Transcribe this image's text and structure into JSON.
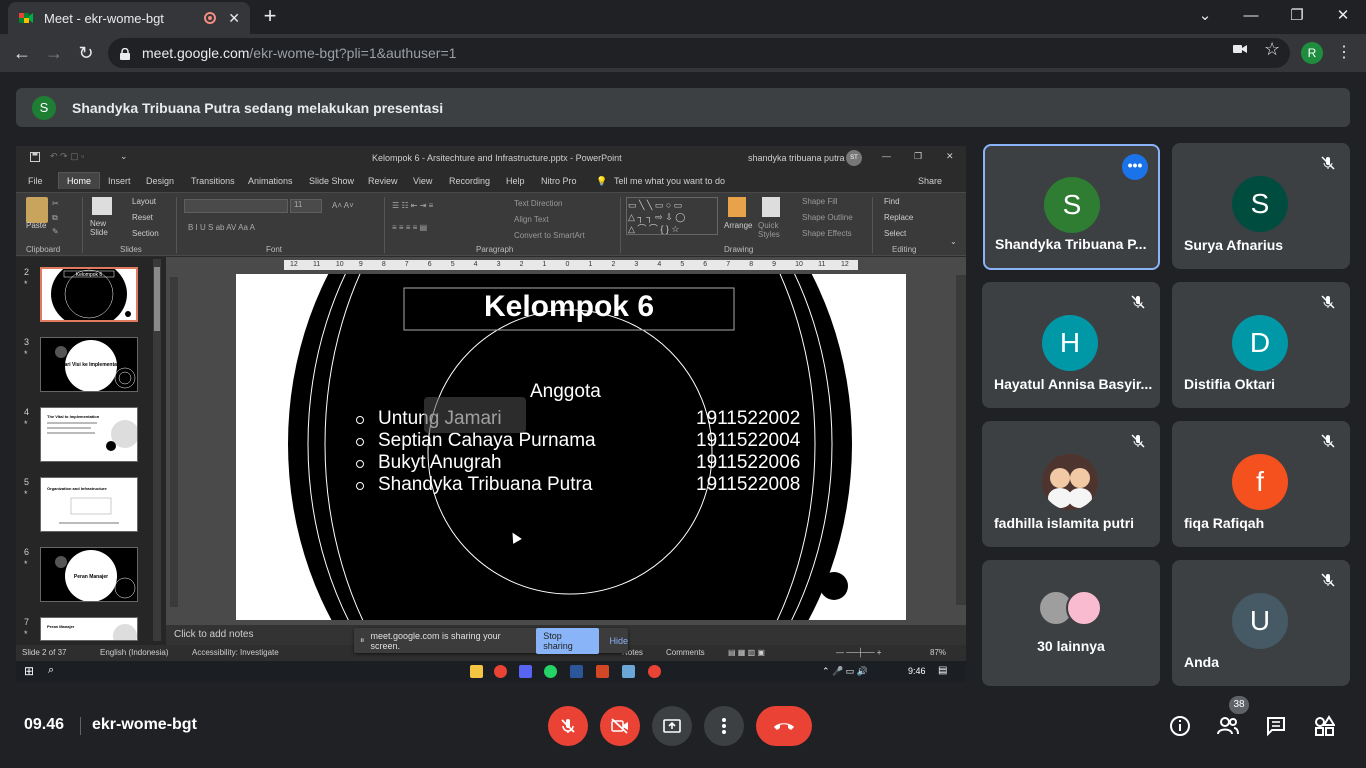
{
  "browser": {
    "tab_title": "Meet - ekr-wome-bgt",
    "url_host": "meet.google.com",
    "url_path": "/ekr-wome-bgt?pli=1&authuser=1",
    "profile_initial": "R"
  },
  "banner": {
    "avatar_initial": "S",
    "text": "Shandyka Tribuana Putra sedang melakukan presentasi"
  },
  "powerpoint": {
    "window_title": "Kelompok 6 - Arsitechture and Infrastructure.pptx - PowerPoint",
    "user": "shandyka tribuana putra",
    "user_initials": "ST",
    "menus": [
      "File",
      "Home",
      "Insert",
      "Design",
      "Transitions",
      "Animations",
      "Slide Show",
      "Review",
      "View",
      "Recording",
      "Help",
      "Nitro Pro"
    ],
    "tell_me": "Tell me what you want to do",
    "share": "Share",
    "ribbon": {
      "paste": "Paste",
      "clipboard": "Clipboard",
      "new_slide": "New Slide",
      "layout": "Layout",
      "reset": "Reset",
      "section": "Section",
      "slides": "Slides",
      "font_group": "Font",
      "font_size": "11",
      "paragraph": "Paragraph",
      "text_direction": "Text Direction",
      "align_text": "Align Text",
      "convert_smartart": "Convert to SmartArt",
      "arrange": "Arrange",
      "quick_styles": "Quick Styles",
      "shape_fill": "Shape Fill",
      "shape_outline": "Shape Outline",
      "shape_effects": "Shape Effects",
      "drawing": "Drawing",
      "find": "Find",
      "replace": "Replace",
      "select": "Select",
      "editing": "Editing"
    },
    "thumbnails": [
      {
        "num": "2",
        "star": "*",
        "caption": "Kelompok 6"
      },
      {
        "num": "3",
        "star": "*",
        "caption": "Dari Visi ke Implementasi"
      },
      {
        "num": "4",
        "star": "*",
        "caption": "The Vital to Implementation"
      },
      {
        "num": "5",
        "star": "*",
        "caption": "Organization and Infrastructure"
      },
      {
        "num": "6",
        "star": "*",
        "caption": "Peran Manajer"
      },
      {
        "num": "7",
        "star": "*",
        "caption": "Peran Manajer"
      }
    ],
    "ruler_ticks": [
      "12",
      "11",
      "10",
      "9",
      "8",
      "7",
      "6",
      "5",
      "4",
      "3",
      "2",
      "1",
      "0",
      "1",
      "2",
      "3",
      "4",
      "5",
      "6",
      "7",
      "8",
      "9",
      "10",
      "11",
      "12"
    ],
    "slide": {
      "title": "Kelompok 6",
      "subtitle": "Anggota",
      "members": [
        {
          "name": "Untung Jamari",
          "nim": "1911522002"
        },
        {
          "name": "Septian Cahaya Purnama",
          "nim": "1911522004"
        },
        {
          "name": "Bukyt Anugrah",
          "nim": "1911522006"
        },
        {
          "name": "Shandyka Tribuana Putra",
          "nim": "1911522008"
        }
      ]
    },
    "notes_placeholder": "Click to add notes",
    "status": {
      "slide_of": "Slide 2 of 37",
      "language": "English (Indonesia)",
      "accessibility": "Accessibility: Investigate",
      "notes": "Notes",
      "comments": "Comments",
      "zoom": "87%",
      "clock": "9:46"
    }
  },
  "sharebar": {
    "text": "meet.google.com is sharing your screen.",
    "stop": "Stop sharing",
    "hide": "Hide"
  },
  "participants": [
    {
      "name": "Shandyka Tribuana P...",
      "initial": "S",
      "color": "#2e7d32",
      "active": true
    },
    {
      "name": "Surya Afnarius",
      "initial": "S",
      "color": "#004d40",
      "active": false
    },
    {
      "name": "Hayatul Annisa Basyir...",
      "initial": "H",
      "color": "#0097a7",
      "active": false
    },
    {
      "name": "Distifia Oktari",
      "initial": "D",
      "color": "#0097a7",
      "active": false
    },
    {
      "name": "fadhilla islamita putri",
      "initial": "",
      "color": "#6d4c41",
      "active": false
    },
    {
      "name": "fiqa Rafiqah",
      "initial": "f",
      "color": "#f4511e",
      "active": false
    },
    {
      "name": "30 lainnya",
      "initial": "",
      "color": "#5f6368",
      "active": false
    },
    {
      "name": "Anda",
      "initial": "U",
      "color": "#455a64",
      "active": false
    }
  ],
  "bottom": {
    "time": "09.46",
    "meeting_code": "ekr-wome-bgt",
    "people_count": "38"
  }
}
